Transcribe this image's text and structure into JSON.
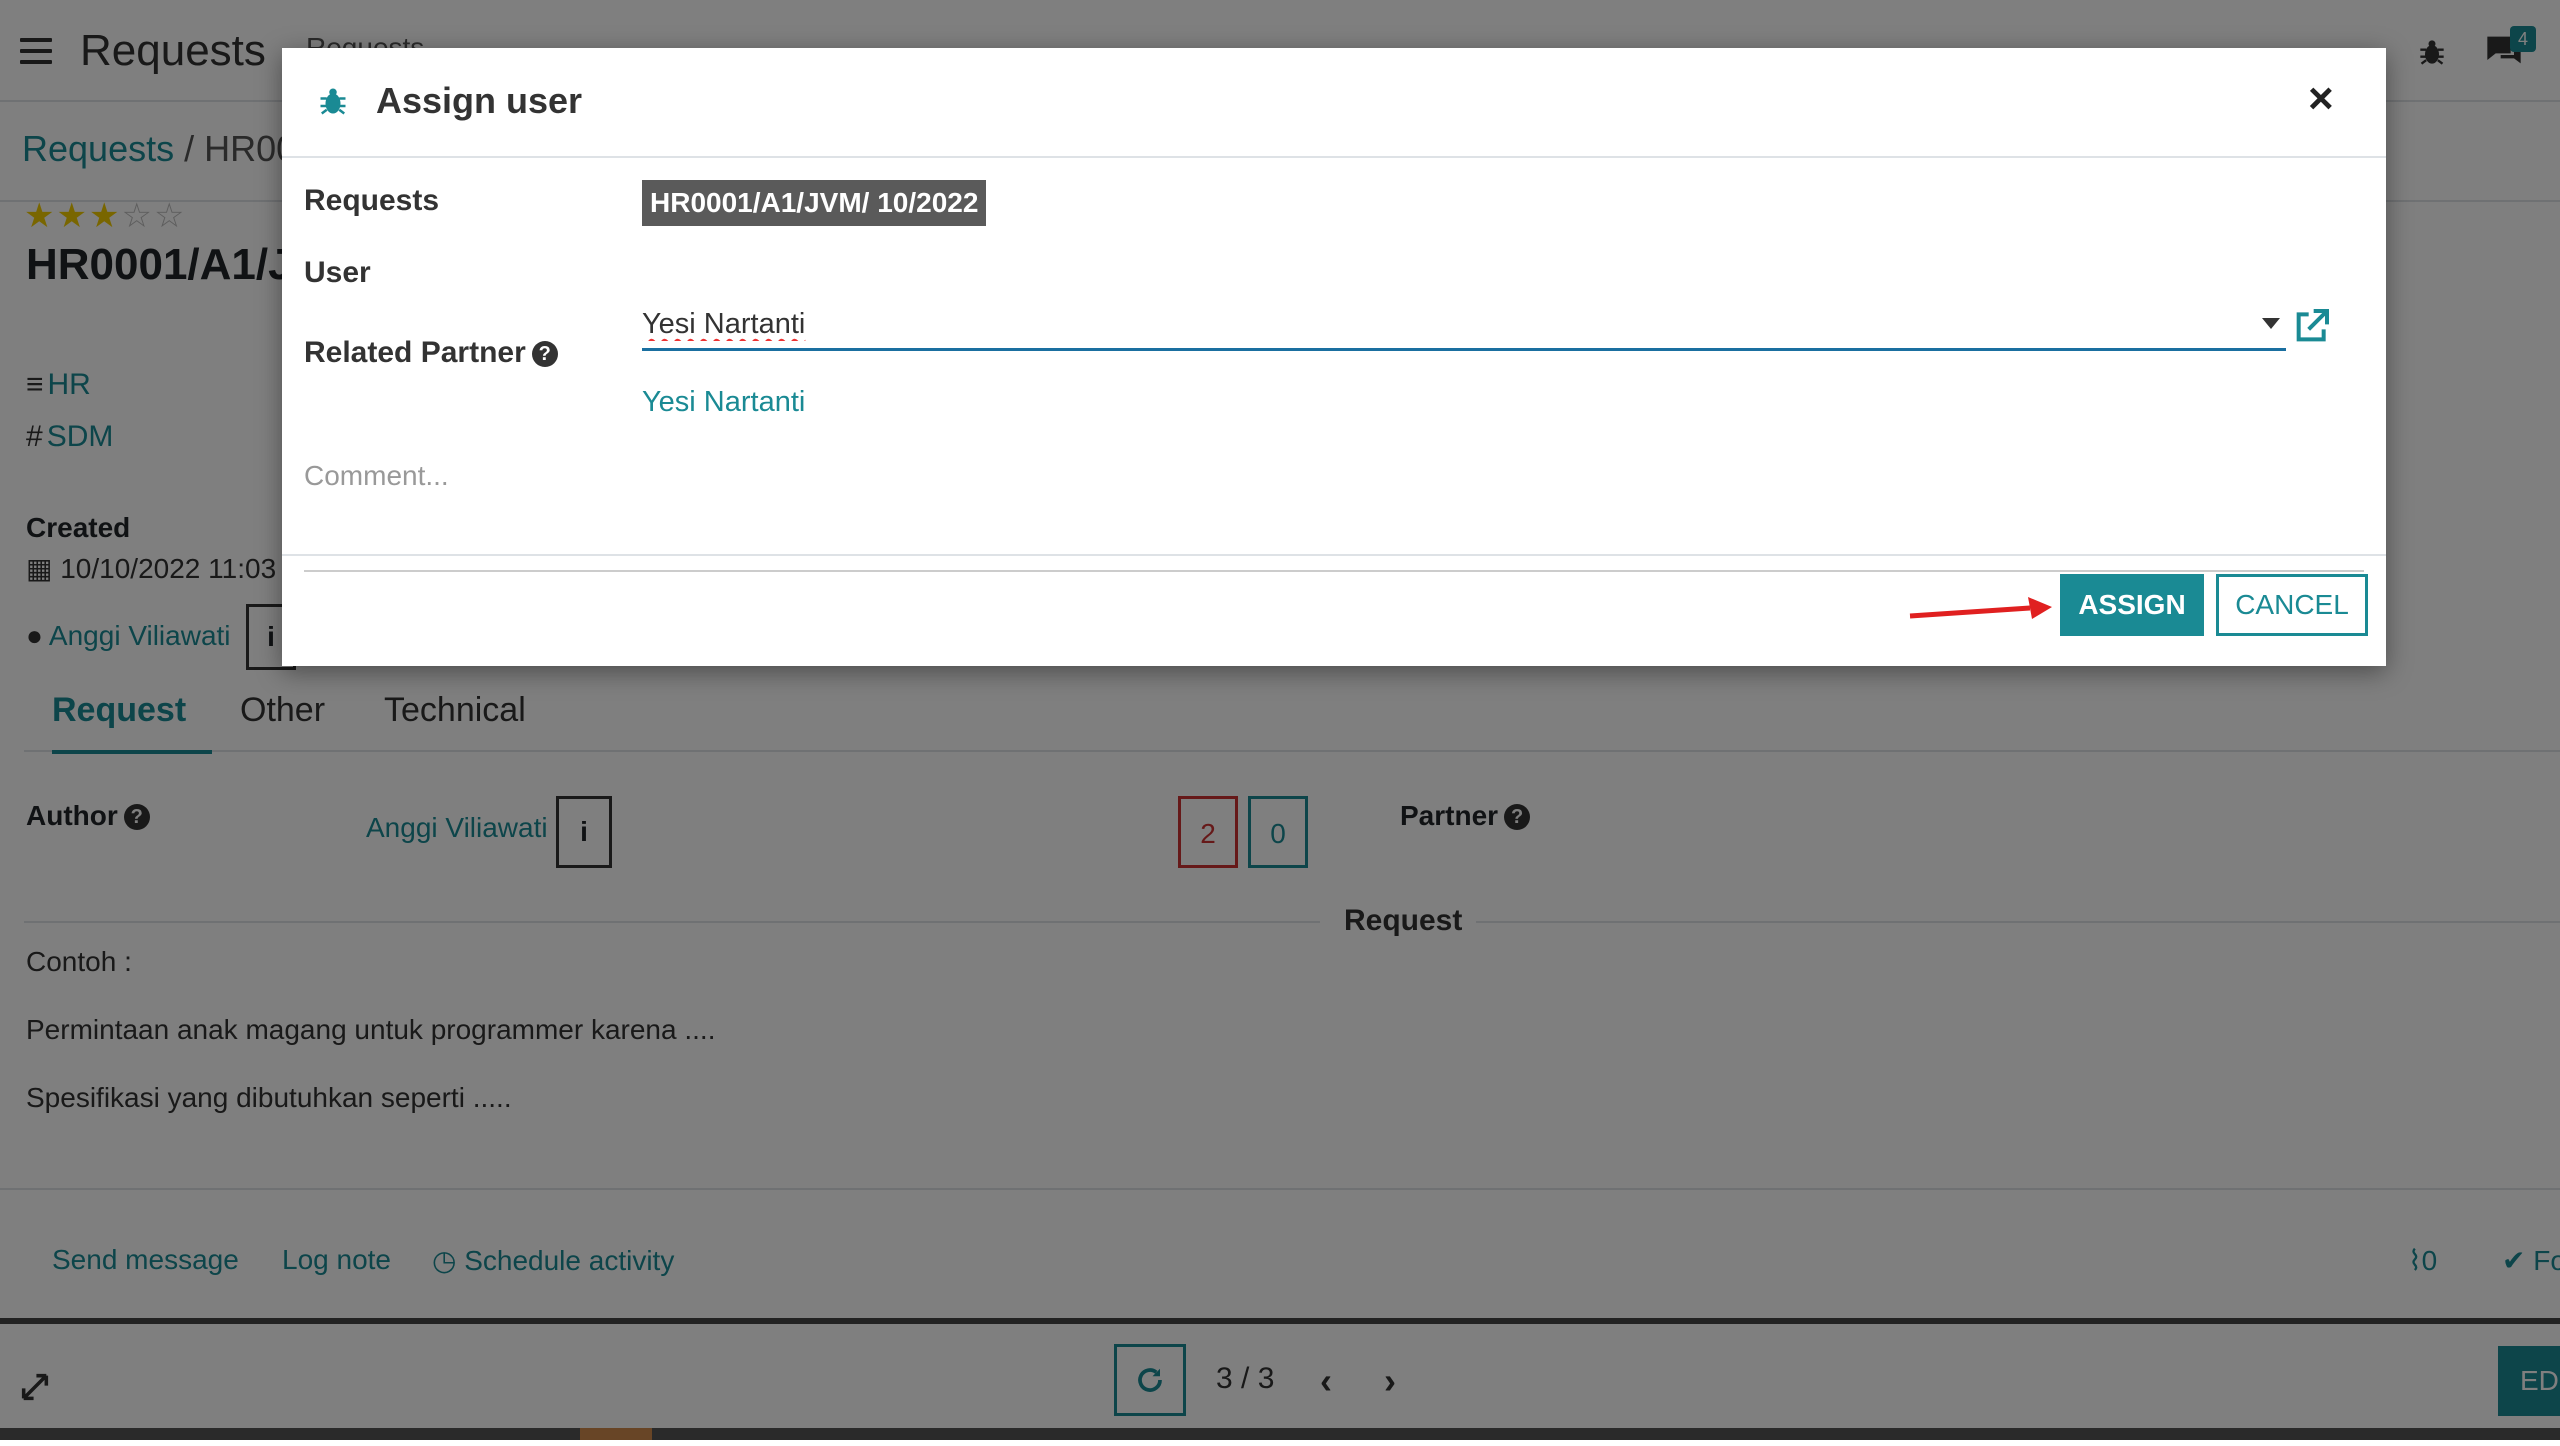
{
  "colors": {
    "accent": "#1a8a94",
    "danger": "#cc3333",
    "annotation_arrow": "#e02020"
  },
  "topbar": {
    "app_title": "Requests",
    "menu_item": "Requests",
    "chat_badge": "4"
  },
  "breadcrumb": {
    "parent": "Requests",
    "separator": "/",
    "current": "HR00"
  },
  "record": {
    "rating": 3,
    "rating_max": 5,
    "title": "HR0001/A1/J",
    "category": "HR",
    "tag": "SDM",
    "created_label": "Created",
    "created_value": "10/10/2022 11:03",
    "owner": "Anggi Viliawati",
    "info_glyph": "i"
  },
  "tabs": [
    {
      "label": "Request",
      "active": true
    },
    {
      "label": "Other",
      "active": false
    },
    {
      "label": "Technical",
      "active": false
    }
  ],
  "details": {
    "author_label": "Author",
    "author_value": "Anggi Viliawati",
    "counter_red": "2",
    "counter_teal": "0",
    "partner_label": "Partner",
    "section_title": "Request",
    "body_lines": [
      "Contoh :",
      "Permintaan anak magang untuk programmer karena ....",
      "Spesifikasi yang dibutuhkan seperti ....."
    ]
  },
  "chatter": {
    "send_message": "Send message",
    "log_note": "Log note",
    "schedule_activity": "Schedule activity",
    "attachments": "0",
    "follow": "Fo"
  },
  "pager": {
    "value": "3 / 3",
    "prev": "‹",
    "next": "›"
  },
  "edit_button": "ED",
  "dialog": {
    "title": "Assign user",
    "close_glyph": "×",
    "requests_label": "Requests",
    "requests_value": "HR0001/A1/JVM/ 10/2022",
    "user_label": "User",
    "user_value": "Yesi Nartanti",
    "related_partner_label": "Related Partner",
    "related_partner_value": "Yesi Nartanti",
    "comment_placeholder": "Comment...",
    "assign_label": "ASSIGN",
    "cancel_label": "CANCEL"
  },
  "icons": {
    "menu": "hamburger-icon",
    "bug": "bug-icon",
    "chat": "chat-icon",
    "external": "external-link-icon",
    "help": "question-circle-icon",
    "calendar": "calendar-icon",
    "user": "user-icon",
    "refresh": "refresh-icon",
    "expand": "expand-icon",
    "clock": "clock-icon",
    "paperclip": "paperclip-icon",
    "check": "check-icon"
  }
}
